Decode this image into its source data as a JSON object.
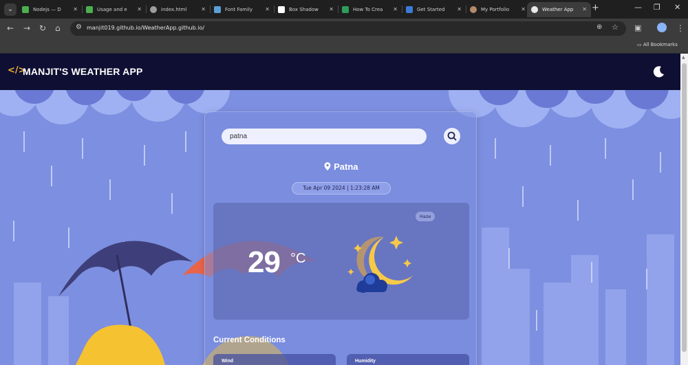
{
  "browser": {
    "tabs": [
      {
        "label": "Nodejs — D",
        "fav": "#4caf50"
      },
      {
        "label": "Usage and e",
        "fav": "#4caf50"
      },
      {
        "label": "index.html",
        "fav": "#9e9e9e"
      },
      {
        "label": "Font Family",
        "fav": "#5aa0d8"
      },
      {
        "label": "Box Shadow",
        "fav": "#ffffff"
      },
      {
        "label": "How To Crea",
        "fav": "#2e9e5b"
      },
      {
        "label": "Get Started",
        "fav": "#3b7bd8"
      },
      {
        "label": "My Portfolio",
        "fav": "#b48a6a"
      },
      {
        "label": "Weather App",
        "fav": "#e8e8e8"
      }
    ],
    "url": "manjit019.github.io/WeatherApp.github.io/",
    "bookmarks_label": "All Bookmarks"
  },
  "app": {
    "title": "MANJIT'S WEATHER APP",
    "search_value": "patna",
    "city": "Patna",
    "datetime": "Tue Apr 09 2024 | 1:23:28 AM",
    "condition": "Haze",
    "temperature": "29",
    "unit": "°C",
    "current_conditions_title": "Current Conditions",
    "conditions": [
      {
        "label": "Wind"
      },
      {
        "label": "Humidity"
      }
    ]
  },
  "colors": {
    "header_bg": "#0e0f33",
    "accent": "#f5b13a",
    "sky": "#7d8fe0"
  }
}
